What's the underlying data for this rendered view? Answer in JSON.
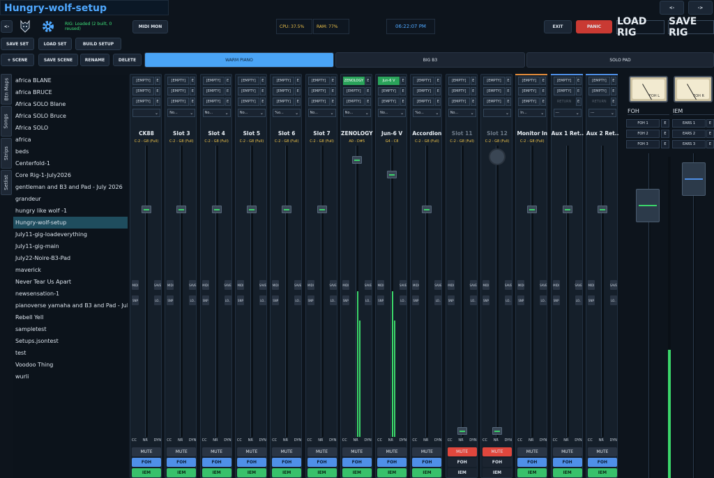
{
  "header": {
    "title": "Hungry-wolf-setup",
    "back": "<-",
    "nav_prev": "<-",
    "nav_next": "->",
    "rig_status": "RIG: Loaded (2 built, 0 reused)",
    "midi_mon": "MIDI MON",
    "cpu": "CPU: 37.5%",
    "ram": "RAM: 77%",
    "clock": "06:22:07 PM",
    "exit": "EXIT",
    "panic": "PANIC",
    "load_rig": "LOAD RIG",
    "save_rig": "SAVE RIG"
  },
  "toolbar": {
    "save_set": "SAVE SET",
    "load_set": "LOAD SET",
    "build_setup": "BUILD SETUP",
    "add_scene": "+ SCENE",
    "save_scene": "SAVE SCENE",
    "rename": "RENAME",
    "delete": "DELETE"
  },
  "scenes": [
    {
      "label": "WARM PIANO",
      "active": true
    },
    {
      "label": "BIG B3",
      "active": false
    },
    {
      "label": "SOLO PAD",
      "active": false
    }
  ],
  "side_tabs": [
    "Btn Maps",
    "Songs",
    "Strips",
    "Setlist"
  ],
  "songs": [
    "africa BLANE",
    "africa BRUCE",
    "Africa SOLO Blane",
    "Africa SOLO Bruce",
    "Africa SOLO",
    "africa",
    "beds",
    "Centerfold-1",
    "Core Rig-1-July2026",
    "gentleman and B3 and Pad - July 2026",
    "grandeur",
    "hungry like wolf -1",
    "Hungry-wolf-setup",
    "July11-gig-loadeverything",
    "July11-gig-main",
    "July22-Noire-B3-Pad",
    "maverick",
    "Never Tear Us Apart",
    "newsensation-1",
    "pianoverse yamaha and B3 and Pad - July ...",
    "Rebell Yell",
    "sampletest",
    "Setups.jsontest",
    "test",
    "Voodoo Thing",
    "wurli"
  ],
  "selected_song": "Hungry-wolf-setup",
  "strip_labels": {
    "cc": "CC",
    "nr": "NR",
    "dyn": "DYN",
    "mute": "MUTE",
    "foh": "FOH",
    "iem": "IEM",
    "midi": "MIDI",
    "save": "SAVE",
    "snp": "SNP",
    "lo": "LO..",
    "e": "E"
  },
  "strips": [
    {
      "name": "CK88",
      "range": "C-2 - G8 (Full)",
      "slots": [
        "[EMPTY]",
        "[EMPTY]",
        "[EMPTY]"
      ],
      "sel": "",
      "fader": 0.78,
      "meter": 0,
      "mute": false
    },
    {
      "name": "Slot 3",
      "range": "C-2 - G8 (Full)",
      "slots": [
        "[EMPTY]",
        "[EMPTY]",
        "[EMPTY]"
      ],
      "sel": "No...",
      "fader": 0.78,
      "meter": 0,
      "mute": false
    },
    {
      "name": "Slot 4",
      "range": "C-2 - G8 (Full)",
      "slots": [
        "[EMPTY]",
        "[EMPTY]",
        "[EMPTY]"
      ],
      "sel": "No...",
      "fader": 0.78,
      "meter": 0,
      "mute": false
    },
    {
      "name": "Slot 5",
      "range": "C-2 - G8 (Full)",
      "slots": [
        "[EMPTY]",
        "[EMPTY]",
        "[EMPTY]"
      ],
      "sel": "No...",
      "fader": 0.78,
      "meter": 0,
      "mute": false
    },
    {
      "name": "Slot 6",
      "range": "C-2 - G8 (Full)",
      "slots": [
        "[EMPTY]",
        "[EMPTY]",
        "[EMPTY]"
      ],
      "sel": "%o...",
      "fader": 0.78,
      "meter": 0,
      "mute": false
    },
    {
      "name": "Slot 7",
      "range": "C-2 - G8 (Full)",
      "slots": [
        "[EMPTY]",
        "[EMPTY]",
        "[EMPTY]"
      ],
      "sel": "No...",
      "fader": 0.78,
      "meter": 0,
      "mute": false
    },
    {
      "name": "ZENOLOGY",
      "range": "A0 - D#5",
      "slots": [
        "ZENOLOGY",
        "[EMPTY]",
        "[EMPTY]"
      ],
      "sel": "No...",
      "fader": 0.95,
      "meter": 0.5,
      "mute": false
    },
    {
      "name": "Jun-6 V",
      "range": "G4 - C8",
      "slots": [
        "Jun-6 V",
        "[EMPTY]",
        "[EMPTY]"
      ],
      "sel": "No...",
      "fader": 0.9,
      "meter": 0.5,
      "mute": false
    },
    {
      "name": "Accordion",
      "range": "C-2 - G8 (Full)",
      "slots": [
        "[EMPTY]",
        "[EMPTY]",
        "[EMPTY]"
      ],
      "sel": "%o...",
      "fader": 0.78,
      "meter": 0,
      "mute": false
    },
    {
      "name": "Slot 11",
      "range": "C-2 - G8 (Full)",
      "slots": [
        "[EMPTY]",
        "[EMPTY]",
        "[EMPTY]"
      ],
      "sel": "No...",
      "fader": 0.02,
      "meter": 0,
      "mute": true,
      "dim": true
    },
    {
      "name": "Slot 12",
      "range": "C-2 - G8 (Full)",
      "slots": [
        "[EMPTY]",
        "[EMPTY]",
        "[EMPTY]"
      ],
      "sel": "",
      "fader": 0.02,
      "meter": 0,
      "mute": true,
      "dim": true
    },
    {
      "name": "Monitor In",
      "range": "C-2 - G8 (Full)",
      "slots": [
        "[EMPTY]",
        "[EMPTY]",
        "[EMPTY]"
      ],
      "sel": "In...",
      "fader": 0.78,
      "meter": 0,
      "mute": false
    },
    {
      "name": "Aux 1 Ret...",
      "range": "",
      "slots": [
        "[EMPTY]",
        "[EMPTY]",
        "RETURN"
      ],
      "sel": "---",
      "fader": 0.78,
      "meter": 0,
      "mute": false
    },
    {
      "name": "Aux 2 Ret...",
      "range": "",
      "slots": [
        "[EMPTY]",
        "[EMPTY]",
        "RETURN"
      ],
      "sel": "---",
      "fader": 0.78,
      "meter": 0,
      "mute": false
    }
  ],
  "master": {
    "foh_title": "FOH",
    "iem_title": "IEM",
    "foh_vu": "FOH L",
    "iem_vu": "FOH R",
    "foh_buses": [
      "FOH 1",
      "FOH 2",
      "FOH 3"
    ],
    "iem_buses": [
      "EARS 1",
      "EARS 2",
      "EARS 3"
    ],
    "foh_level": 0.84,
    "iem_level": 0.92,
    "iem_meter": 0.4
  }
}
